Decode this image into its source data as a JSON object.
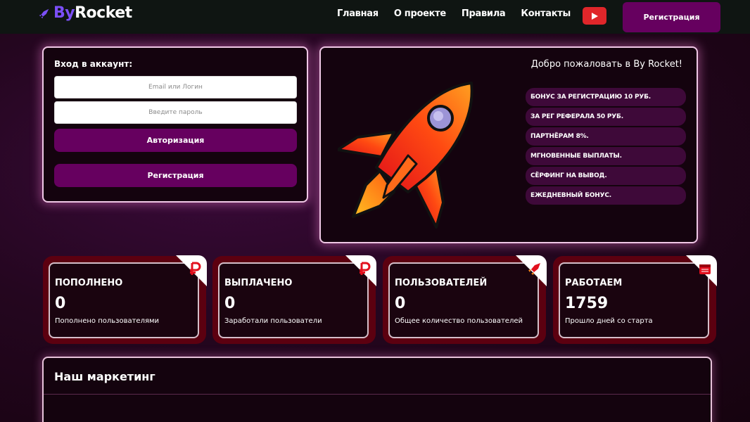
{
  "header": {
    "logo_by": "By",
    "logo_rocket": "Rocket",
    "nav": [
      "Главная",
      "О проекте",
      "Правила",
      "Контакты"
    ],
    "register_label": "Регистрация"
  },
  "login": {
    "title": "Вход в аккаунт:",
    "login_placeholder": "Email или Логин",
    "password_placeholder": "Введите пароль",
    "auth_label": "Авторизация",
    "register_label": "Регистрация"
  },
  "welcome": {
    "title": "Добро пожаловать в By Rocket!",
    "features": [
      "БОНУС ЗА РЕГИСТРАЦИЮ 10 РУБ.",
      "ЗА РЕГ РЕФЕРАЛА 50 РУБ.",
      "ПАРТНЁРАМ 8%.",
      "МГНОВЕННЫЕ ВЫПЛАТЫ.",
      "СЁРФИНГ НА ВЫВОД.",
      "ЕЖЕДНЕВНЫЙ БОНУС."
    ]
  },
  "stats": [
    {
      "label": "ПОПОЛНЕНО",
      "value": "0",
      "desc": "Пополнено пользователями",
      "icon": "ruble-icon"
    },
    {
      "label": "ВЫПЛАЧЕНО",
      "value": "0",
      "desc": "Заработали пользователи",
      "icon": "ruble-icon"
    },
    {
      "label": "ПОЛЬЗОВАТЕЛЕЙ",
      "value": "0",
      "desc": "Общее количество пользователей",
      "icon": "rocket-icon"
    },
    {
      "label": "РАБОТАЕМ",
      "value": "1759",
      "desc": "Прошло дней со старта",
      "icon": "calendar-icon"
    }
  ],
  "marketing": {
    "title": "Наш маркетинг"
  },
  "colors": {
    "accent": "#66005f",
    "logo_by": "#7b4ff7",
    "youtube": "#e0262a",
    "stat_frame": "#5c0010",
    "stat_icon": "#e2101e"
  }
}
